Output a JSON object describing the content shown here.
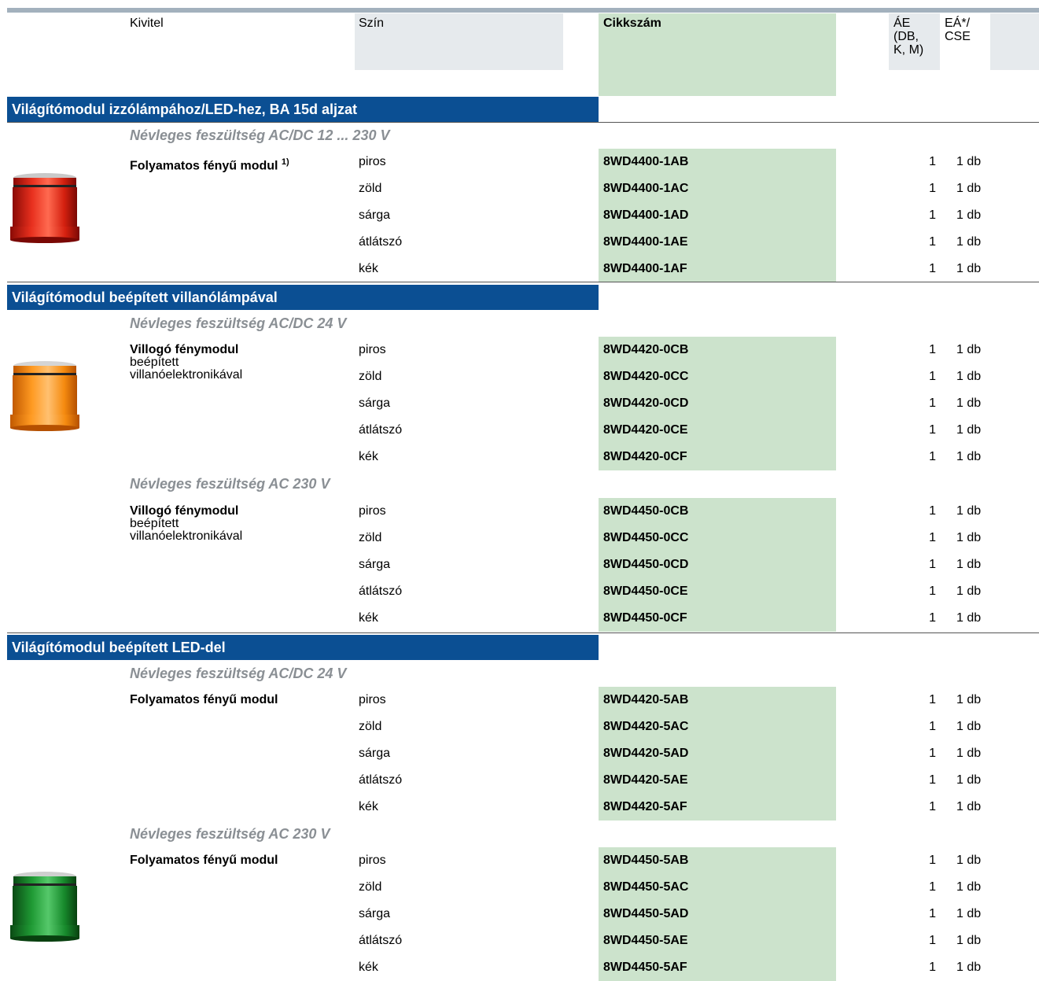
{
  "header": {
    "kivitel": "Kivitel",
    "szin": "Szín",
    "cikkszam": "Cikkszám",
    "ae_1": "ÁE",
    "ae_2": "(DB,",
    "ae_3": "K, M)",
    "ea_1": "EÁ*/",
    "ea_2": "CSE"
  },
  "sections": [
    {
      "title": "Világítómodul izzólámpához/LED-hez, BA 15d aljzat",
      "groups": [
        {
          "voltage": "Névleges feszültség AC/DC 12 ... 230 V",
          "product": "Folyamatos fényű modul",
          "footnote": "1)",
          "rows": [
            {
              "color": "piros",
              "code": "8WD4400-1AB",
              "qty": "1",
              "unit": "1 db"
            },
            {
              "color": "zöld",
              "code": "8WD4400-1AC",
              "qty": "1",
              "unit": "1 db"
            },
            {
              "color": "sárga",
              "code": "8WD4400-1AD",
              "qty": "1",
              "unit": "1 db"
            },
            {
              "color": "átlátszó",
              "code": "8WD4400-1AE",
              "qty": "1",
              "unit": "1 db"
            },
            {
              "color": "kék",
              "code": "8WD4400-1AF",
              "qty": "1",
              "unit": "1 db"
            }
          ]
        }
      ]
    },
    {
      "title": "Világítómodul beépített villanólámpával",
      "groups": [
        {
          "voltage": "Névleges feszültség AC/DC 24 V",
          "product": "Villogó fénymodul",
          "product_sub_1": "beépített",
          "product_sub_2": "villanóelektronikával",
          "rows": [
            {
              "color": "piros",
              "code": "8WD4420-0CB",
              "qty": "1",
              "unit": "1 db"
            },
            {
              "color": "zöld",
              "code": "8WD4420-0CC",
              "qty": "1",
              "unit": "1 db"
            },
            {
              "color": "sárga",
              "code": "8WD4420-0CD",
              "qty": "1",
              "unit": "1 db"
            },
            {
              "color": "átlátszó",
              "code": "8WD4420-0CE",
              "qty": "1",
              "unit": "1 db"
            },
            {
              "color": "kék",
              "code": "8WD4420-0CF",
              "qty": "1",
              "unit": "1 db"
            }
          ]
        },
        {
          "voltage": "Névleges feszültség AC 230 V",
          "product": "Villogó fénymodul",
          "product_sub_1": "beépített",
          "product_sub_2": "villanóelektronikával",
          "rows": [
            {
              "color": "piros",
              "code": "8WD4450-0CB",
              "qty": "1",
              "unit": "1 db"
            },
            {
              "color": "zöld",
              "code": "8WD4450-0CC",
              "qty": "1",
              "unit": "1 db"
            },
            {
              "color": "sárga",
              "code": "8WD4450-0CD",
              "qty": "1",
              "unit": "1 db"
            },
            {
              "color": "átlátszó",
              "code": "8WD4450-0CE",
              "qty": "1",
              "unit": "1 db"
            },
            {
              "color": "kék",
              "code": "8WD4450-0CF",
              "qty": "1",
              "unit": "1 db"
            }
          ]
        }
      ]
    },
    {
      "title": "Világítómodul beépített LED-del",
      "groups": [
        {
          "voltage": "Névleges feszültség AC/DC 24 V",
          "product": "Folyamatos fényű modul",
          "rows": [
            {
              "color": "piros",
              "code": "8WD4420-5AB",
              "qty": "1",
              "unit": "1 db"
            },
            {
              "color": "zöld",
              "code": "8WD4420-5AC",
              "qty": "1",
              "unit": "1 db"
            },
            {
              "color": "sárga",
              "code": "8WD4420-5AD",
              "qty": "1",
              "unit": "1 db"
            },
            {
              "color": "átlátszó",
              "code": "8WD4420-5AE",
              "qty": "1",
              "unit": "1 db"
            },
            {
              "color": "kék",
              "code": "8WD4420-5AF",
              "qty": "1",
              "unit": "1 db"
            }
          ]
        },
        {
          "voltage": "Névleges feszültség AC 230 V",
          "product": "Folyamatos fényű modul",
          "rows": [
            {
              "color": "piros",
              "code": "8WD4450-5AB",
              "qty": "1",
              "unit": "1 db"
            },
            {
              "color": "zöld",
              "code": "8WD4450-5AC",
              "qty": "1",
              "unit": "1 db"
            },
            {
              "color": "sárga",
              "code": "8WD4450-5AD",
              "qty": "1",
              "unit": "1 db"
            },
            {
              "color": "átlátszó",
              "code": "8WD4450-5AE",
              "qty": "1",
              "unit": "1 db"
            },
            {
              "color": "kék",
              "code": "8WD4450-5AF",
              "qty": "1",
              "unit": "1 db"
            }
          ]
        }
      ]
    }
  ],
  "colors": {
    "section_blue": "#0b4f93",
    "code_green": "#cce3cc",
    "header_grey": "#e6eaed",
    "subtitle_grey": "#8a8f94"
  },
  "images": [
    "red-signal-module",
    "orange-signal-module",
    "green-signal-module"
  ]
}
